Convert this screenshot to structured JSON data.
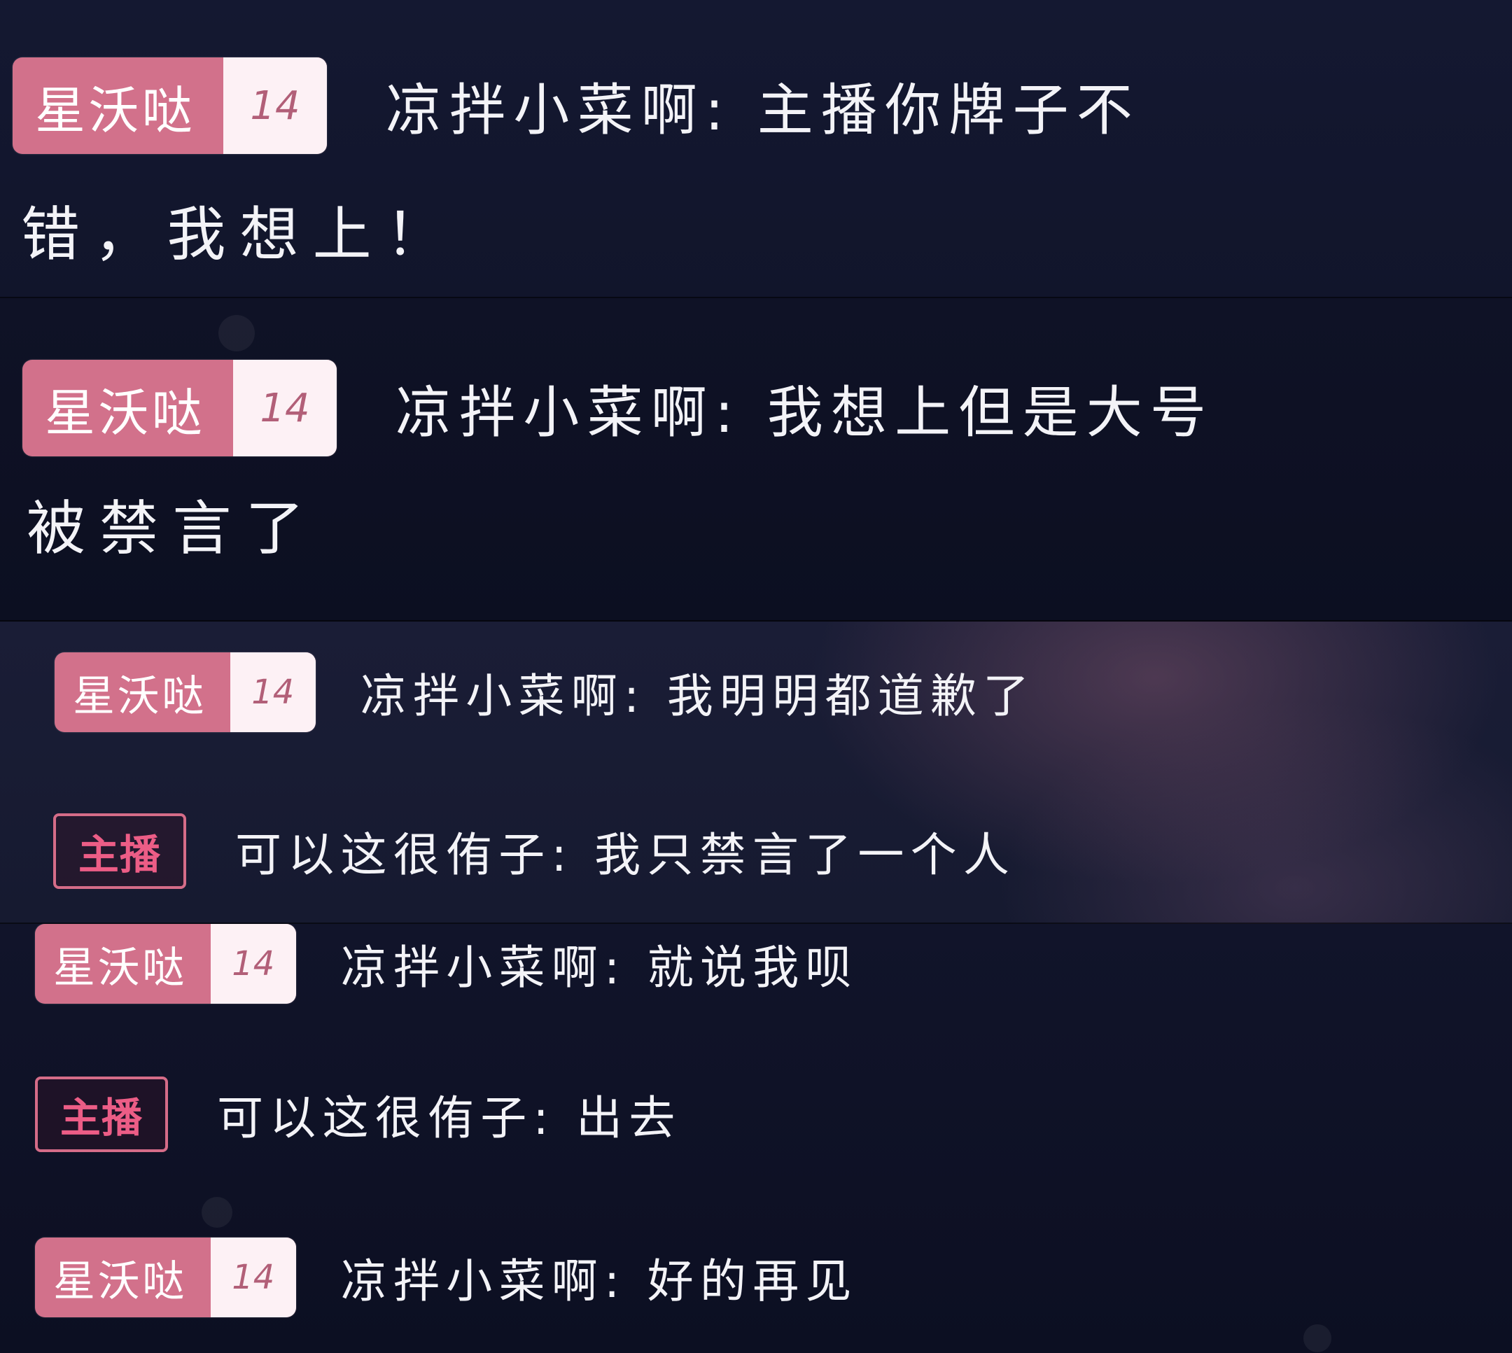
{
  "messages": [
    {
      "badge": {
        "name": "星沃哒",
        "level": "14"
      },
      "user": "凉拌小菜啊",
      "sep": ":",
      "text_line1": "主播你牌子不",
      "text_line2": "错，我想上！"
    },
    {
      "badge": {
        "name": "星沃哒",
        "level": "14"
      },
      "user": "凉拌小菜啊",
      "sep": ":",
      "text_line1": "我想上但是大号",
      "text_line2": "被禁言了"
    },
    {
      "badge": {
        "name": "星沃哒",
        "level": "14"
      },
      "user": "凉拌小菜啊",
      "sep": ":",
      "text": "我明明都道歉了"
    },
    {
      "host_badge": "主播",
      "user": "可以这很侑子",
      "sep": ":",
      "text": "我只禁言了一个人"
    },
    {
      "badge": {
        "name": "星沃哒",
        "level": "14"
      },
      "user": "凉拌小菜啊",
      "sep": ":",
      "text": "就说我呗"
    },
    {
      "host_badge": "主播",
      "user": "可以这很侑子",
      "sep": ":",
      "text": "出去"
    },
    {
      "badge": {
        "name": "星沃哒",
        "level": "14"
      },
      "user": "凉拌小菜啊",
      "sep": ":",
      "text": "好的再见"
    }
  ]
}
